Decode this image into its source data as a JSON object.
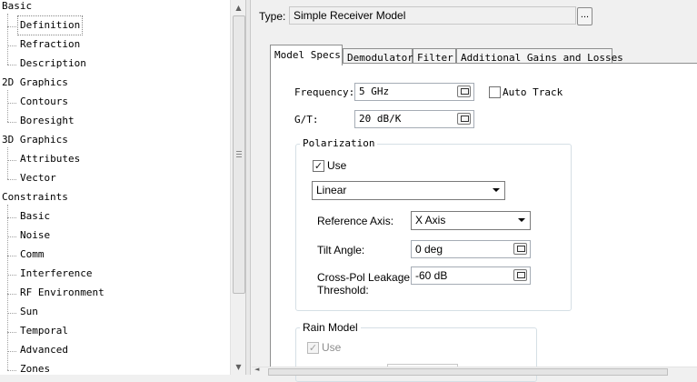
{
  "tree": {
    "items": [
      {
        "label": "Basic",
        "level": 0
      },
      {
        "label": "Definition",
        "level": 1,
        "selected": true
      },
      {
        "label": "Refraction",
        "level": 1
      },
      {
        "label": "Description",
        "level": 1
      },
      {
        "label": "2D Graphics",
        "level": 0
      },
      {
        "label": "Contours",
        "level": 1
      },
      {
        "label": "Boresight",
        "level": 1
      },
      {
        "label": "3D Graphics",
        "level": 0
      },
      {
        "label": "Attributes",
        "level": 1
      },
      {
        "label": "Vector",
        "level": 1
      },
      {
        "label": "Constraints",
        "level": 0
      },
      {
        "label": "Basic",
        "level": 1
      },
      {
        "label": "Noise",
        "level": 1
      },
      {
        "label": "Comm",
        "level": 1
      },
      {
        "label": "Interference",
        "level": 1
      },
      {
        "label": "RF Environment",
        "level": 1
      },
      {
        "label": "Sun",
        "level": 1
      },
      {
        "label": "Temporal",
        "level": 1
      },
      {
        "label": "Advanced",
        "level": 1
      },
      {
        "label": "Zones",
        "level": 1
      }
    ]
  },
  "type_row": {
    "label": "Type:",
    "value": "Simple Receiver Model",
    "browse_label": "..."
  },
  "tabs": [
    {
      "label": "Model Specs",
      "active": true
    },
    {
      "label": "Demodulator"
    },
    {
      "label": "Filter"
    },
    {
      "label": "Additional Gains and Losses"
    }
  ],
  "model_specs": {
    "frequency_label": "Frequency:",
    "frequency_value": "5 GHz",
    "auto_track_label": "Auto Track",
    "auto_track_checked": false,
    "gt_label": "G/T:",
    "gt_value": "20 dB/K",
    "polarization": {
      "title": "Polarization",
      "use_label": "Use",
      "use_checked": true,
      "type_value": "Linear",
      "reference_axis_label": "Reference Axis:",
      "reference_axis_value": "X Axis",
      "tilt_angle_label": "Tilt Angle:",
      "tilt_angle_value": "0 deg",
      "xpol_label_line1": "Cross-Pol Leakage",
      "xpol_label_line2": "Threshold:",
      "xpol_value": "-60 dB"
    },
    "rain_model": {
      "title": "Rain Model",
      "use_label": "Use",
      "use_checked": true,
      "use_enabled": false
    }
  },
  "icons": {
    "checkmark": "✓",
    "scroll_up": "▲",
    "scroll_down": "▼",
    "scroll_left": "◄",
    "scroll_right": "►"
  }
}
